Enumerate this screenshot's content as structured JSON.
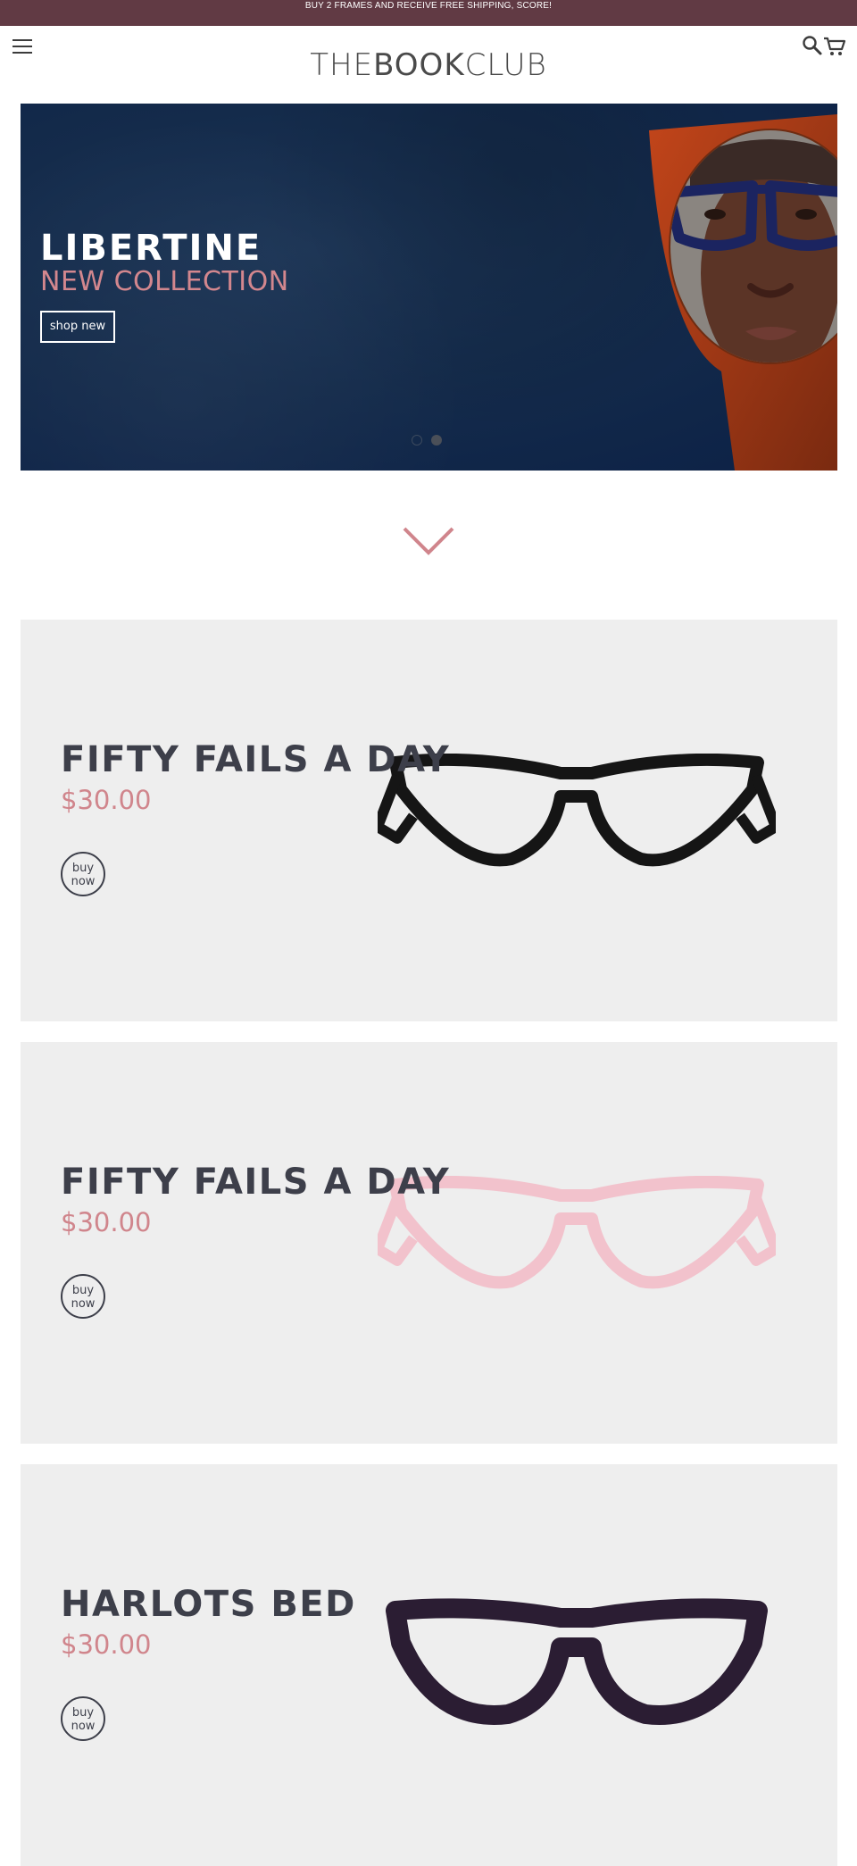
{
  "announcement": {
    "text": "BUY 2 FRAMES AND RECEIVE FREE SHIPPING, SCORE!"
  },
  "header": {
    "logo_prefix": "THE",
    "logo_bold": "BOOK",
    "logo_suffix": "CLUB",
    "menu_icon": "hamburger-icon",
    "search_icon": "search-icon",
    "cart_icon": "cart-icon"
  },
  "hero": {
    "title": "LIBERTINE",
    "subtitle": "NEW COLLECTION",
    "button_label": "shop new",
    "slides_total": 2,
    "active_slide": 2
  },
  "products": [
    {
      "name": "FIFTY FAILS A DAY",
      "price": "$30.00",
      "button": "buy now",
      "frame_color": "#151515"
    },
    {
      "name": "FIFTY FAILS A DAY",
      "price": "$30.00",
      "button": "buy now",
      "frame_color": "#f2c2cc"
    },
    {
      "name": "HARLOTS BED",
      "price": "$30.00",
      "button": "buy now",
      "frame_color": "#2b1d33"
    }
  ],
  "colors": {
    "announcement_bg": "#613a44",
    "accent_pink": "#d0858c",
    "heading_dark": "#3d3f4a",
    "card_bg": "#eeeeee",
    "hero_bg": "#142b4b"
  }
}
